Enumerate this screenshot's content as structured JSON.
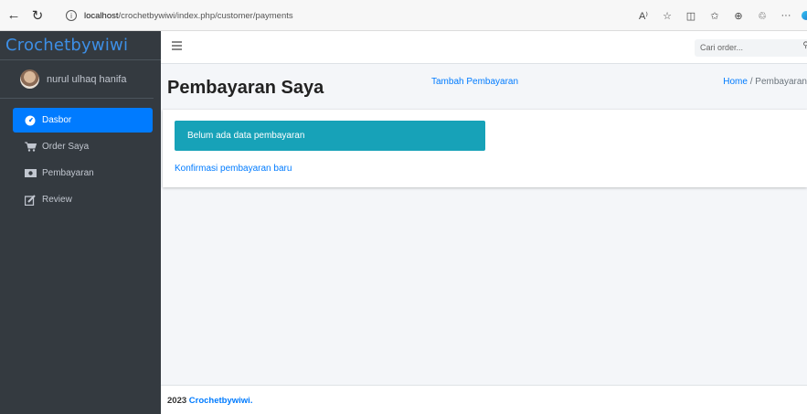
{
  "browser": {
    "back_icon": "←",
    "refresh_icon": "↻",
    "url_host": "localhost",
    "url_path": "/crochetbywiwi/index.php/customer/payments",
    "toolbar_icons": [
      "A⁾",
      "☆",
      "◫",
      "✩",
      "⊕",
      "♲",
      "···"
    ]
  },
  "sidebar": {
    "brand": "Crochetbywiwi",
    "user_name": "nurul ulhaq hanifa",
    "items": [
      {
        "label": "Dasbor",
        "icon": "dashboard-icon",
        "active": true
      },
      {
        "label": "Order Saya",
        "icon": "cart-icon",
        "active": false
      },
      {
        "label": "Pembayaran",
        "icon": "money-icon",
        "active": false
      },
      {
        "label": "Review",
        "icon": "edit-icon",
        "active": false
      }
    ]
  },
  "navbar": {
    "search_placeholder": "Cari order..."
  },
  "header": {
    "title": "Pembayaran Saya",
    "add_link": "Tambah Pembayaran",
    "breadcrumb_home": "Home",
    "breadcrumb_sep": "/",
    "breadcrumb_current": "Pembayaran"
  },
  "card": {
    "alert_text": "Belum ada data pembayaran",
    "confirm_link": "Konfirmasi pembayaran baru"
  },
  "footer": {
    "year": "2023",
    "brand": "Crochetbywiwi."
  },
  "colors": {
    "sidebar_bg": "#343a40",
    "active": "#007bff",
    "alert": "#17a2b8",
    "brand": "#3d8fe6"
  }
}
